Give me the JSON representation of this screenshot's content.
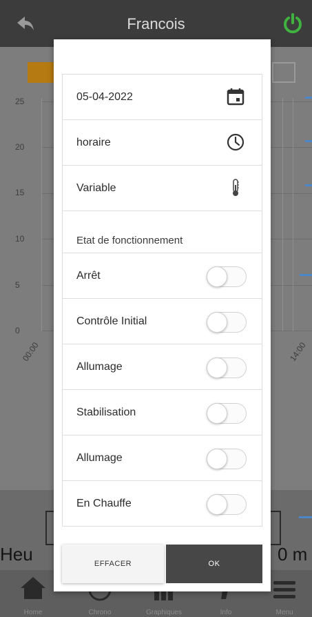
{
  "app": {
    "title": "Francois",
    "chart": {
      "y_ticks": [
        "25",
        "20",
        "15",
        "10",
        "5",
        "0"
      ],
      "x_ticks": [
        "00:00",
        "14:00"
      ]
    },
    "bottom": {
      "left_text": "Heu",
      "right_text": "0 m"
    },
    "nav": [
      {
        "label": "Home",
        "icon": "home-icon"
      },
      {
        "label": "Chrono",
        "icon": "chrono-icon"
      },
      {
        "label": "Graphiques",
        "icon": "bar-chart-icon"
      },
      {
        "label": "Info",
        "icon": "info-icon"
      },
      {
        "label": "Menu",
        "icon": "menu-icon"
      }
    ],
    "colors": {
      "power": "#3fb23f",
      "accent_blue": "#4a86c8",
      "legend_orange": "#b57a12"
    }
  },
  "dialog": {
    "date": "05-04-2022",
    "mode": "horaire",
    "variable": "Variable",
    "section_title": "Etat de fonctionnement",
    "states": [
      {
        "label": "Arrêt",
        "on": false
      },
      {
        "label": "Contrôle Initial",
        "on": false
      },
      {
        "label": "Allumage",
        "on": false
      },
      {
        "label": "Stabilisation",
        "on": false
      },
      {
        "label": "Allumage",
        "on": false
      },
      {
        "label": "En Chauffe",
        "on": false
      }
    ],
    "clear_label": "EFFACER",
    "ok_label": "OK"
  }
}
